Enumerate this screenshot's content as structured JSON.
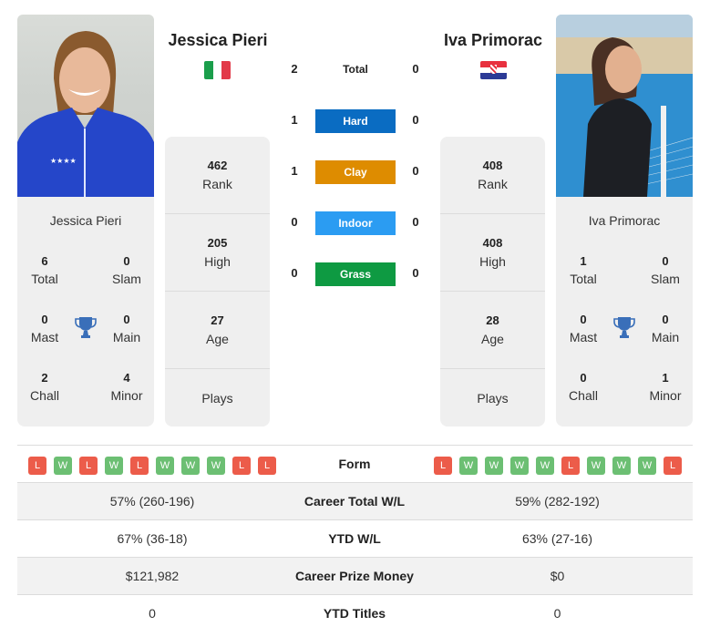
{
  "colors": {
    "hard": "#0a6cc2",
    "clay": "#de8c00",
    "indoor": "#2b9cf2",
    "grass": "#0e9a42",
    "win": "#6cbf73",
    "loss": "#ec5c4a",
    "trophy": "#3a6fb9"
  },
  "player_left": {
    "name": "Jessica Pieri",
    "flag": "italy-flag",
    "card_name": "Jessica Pieri",
    "titles": {
      "total": {
        "value": "6",
        "label": "Total"
      },
      "slam": {
        "value": "0",
        "label": "Slam"
      },
      "mast": {
        "value": "0",
        "label": "Mast"
      },
      "main": {
        "value": "0",
        "label": "Main"
      },
      "chall": {
        "value": "2",
        "label": "Chall"
      },
      "minor": {
        "value": "4",
        "label": "Minor"
      }
    },
    "rank": {
      "value": "462",
      "label": "Rank"
    },
    "high": {
      "value": "205",
      "label": "High"
    },
    "age": {
      "value": "27",
      "label": "Age"
    },
    "plays": {
      "value": "",
      "label": "Plays"
    }
  },
  "player_right": {
    "name": "Iva Primorac",
    "flag": "croatia-flag",
    "card_name": "Iva Primorac",
    "titles": {
      "total": {
        "value": "1",
        "label": "Total"
      },
      "slam": {
        "value": "0",
        "label": "Slam"
      },
      "mast": {
        "value": "0",
        "label": "Mast"
      },
      "main": {
        "value": "0",
        "label": "Main"
      },
      "chall": {
        "value": "0",
        "label": "Chall"
      },
      "minor": {
        "value": "1",
        "label": "Minor"
      }
    },
    "rank": {
      "value": "408",
      "label": "Rank"
    },
    "high": {
      "value": "408",
      "label": "High"
    },
    "age": {
      "value": "28",
      "label": "Age"
    },
    "plays": {
      "value": "",
      "label": "Plays"
    }
  },
  "h2h": [
    {
      "label": "Total",
      "left": "2",
      "right": "0",
      "surface": "total"
    },
    {
      "label": "Hard",
      "left": "1",
      "right": "0",
      "surface": "hard"
    },
    {
      "label": "Clay",
      "left": "1",
      "right": "0",
      "surface": "clay"
    },
    {
      "label": "Indoor",
      "left": "0",
      "right": "0",
      "surface": "indoor"
    },
    {
      "label": "Grass",
      "left": "0",
      "right": "0",
      "surface": "grass"
    }
  ],
  "comparison": {
    "form": {
      "label": "Form",
      "left": [
        "L",
        "W",
        "L",
        "W",
        "L",
        "W",
        "W",
        "W",
        "L",
        "L"
      ],
      "right": [
        "L",
        "W",
        "W",
        "W",
        "W",
        "L",
        "W",
        "W",
        "W",
        "L"
      ]
    },
    "rows": [
      {
        "label": "Career Total W/L",
        "left": "57% (260-196)",
        "right": "59% (282-192)"
      },
      {
        "label": "YTD W/L",
        "left": "67% (36-18)",
        "right": "63% (27-16)"
      },
      {
        "label": "Career Prize Money",
        "left": "$121,982",
        "right": "$0"
      },
      {
        "label": "YTD Titles",
        "left": "0",
        "right": "0"
      }
    ]
  }
}
